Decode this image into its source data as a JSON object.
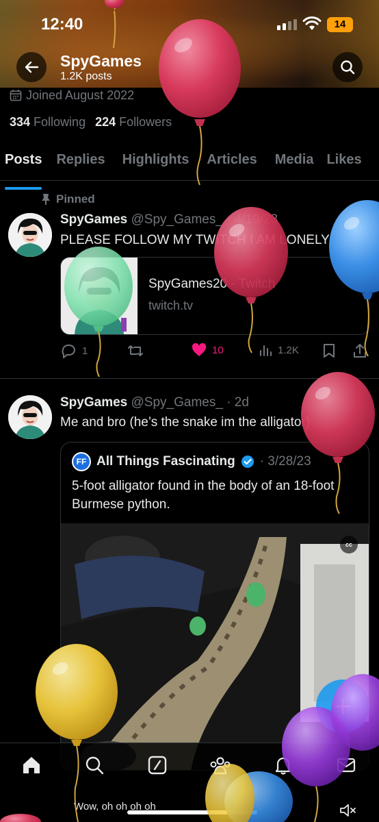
{
  "status_bar": {
    "time": "12:40",
    "battery": "14"
  },
  "topbar": {
    "name": "SpyGames",
    "posts": "1.2K posts"
  },
  "profile": {
    "joined": "Joined August 2022",
    "following_count": "334",
    "following_label": "Following",
    "followers_count": "224",
    "followers_label": "Followers"
  },
  "tabs": [
    "Posts",
    "Replies",
    "Highlights",
    "Articles",
    "Media",
    "Likes"
  ],
  "post1": {
    "pinned": "Pinned",
    "name": "SpyGames",
    "handle_date": "@Spy_Games_ · 4/19/23",
    "text": "PLEASE FOLLOW MY TWITCH I AM LONELY",
    "card_title": "SpyGames20 - Twitch",
    "card_domain": "twitch.tv",
    "replies": "1",
    "likes": "10",
    "views": "1.2K"
  },
  "post2": {
    "name": "SpyGames",
    "handle_date": "@Spy_Games_ · 2d",
    "text": "Me and bro (he’s the snake im the alligator)",
    "quote": {
      "badge": "FF",
      "name": "All Things Fascinating",
      "date": "· 3/28/23",
      "text": "5-foot alligator found in the body of an 18-foot Burmese python.",
      "cc": "cc"
    }
  },
  "video_caption": "Wow, oh oh oh oh",
  "colors": {
    "accent": "#1d9bf0",
    "like": "#f91880",
    "muted": "#71767b"
  }
}
